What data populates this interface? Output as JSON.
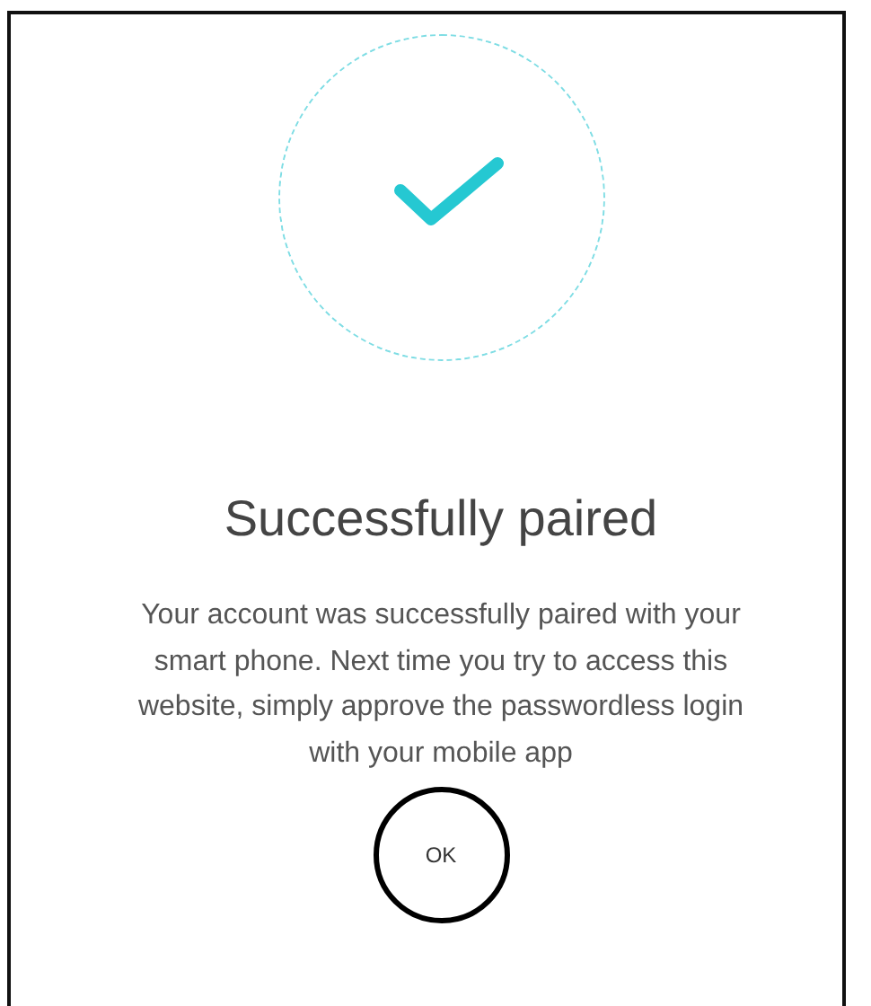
{
  "dialog": {
    "title": "Successfully paired",
    "message": "Your account was successfully paired with your smart phone. Next time you try to access this website, simply approve the passwordless login with your mobile app",
    "button": "OK"
  }
}
